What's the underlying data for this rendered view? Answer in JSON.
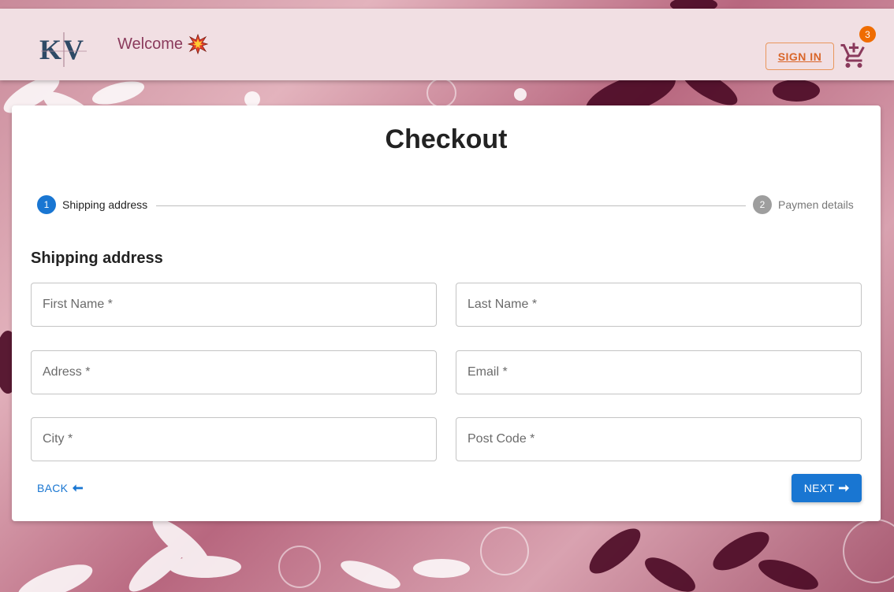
{
  "header": {
    "welcome_text": "Welcome",
    "signin_label": "SIGN IN",
    "cart_count": "3",
    "logo_alt": "KV"
  },
  "checkout": {
    "title": "Checkout",
    "steps": [
      {
        "number": "1",
        "label": "Shipping address",
        "active": true
      },
      {
        "number": "2",
        "label": "Paymen details",
        "active": false
      }
    ],
    "section_title": "Shipping address",
    "fields": {
      "first_name": "First Name *",
      "last_name": "Last Name *",
      "address": "Adress *",
      "email": "Email *",
      "city": "City *",
      "post_code": "Post Code *"
    },
    "back_label": "BACK",
    "next_label": "NEXT"
  },
  "icons": {
    "welcome_emoji": "collision-icon",
    "cart": "add-shopping-cart-icon",
    "back": "arrow-left-icon",
    "next": "arrow-right-icon"
  },
  "colors": {
    "appbar_bg": "#f1dfe3",
    "primary": "#1976d2",
    "signin": "#d9662a",
    "badge": "#ef6c00",
    "welcome": "#8a3a5c"
  }
}
